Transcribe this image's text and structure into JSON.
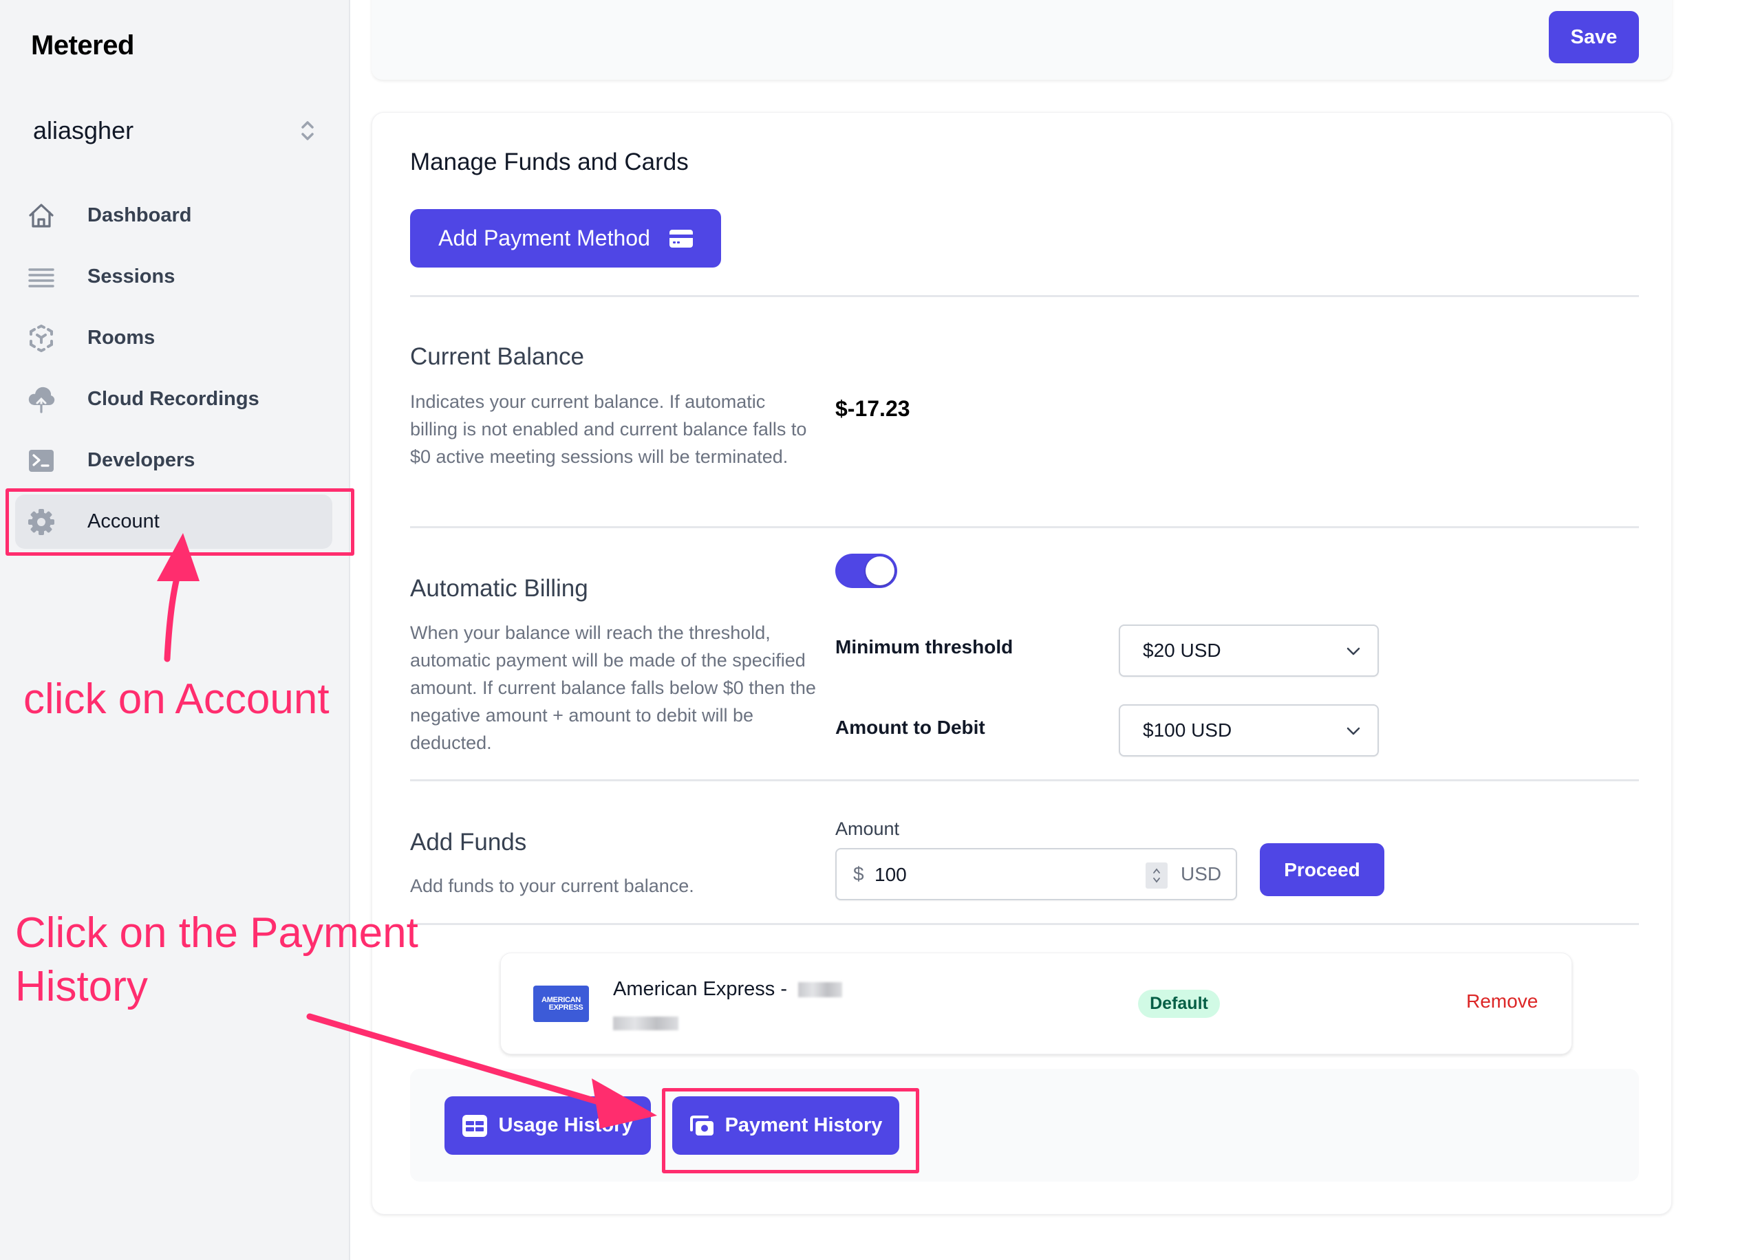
{
  "sidebar": {
    "brand": "Metered",
    "org": {
      "name": "aliasgher",
      "icon": "chevron-up-down-icon"
    },
    "items": [
      {
        "label": "Dashboard",
        "icon": "home-icon",
        "active": false
      },
      {
        "label": "Sessions",
        "icon": "menu-lines-icon",
        "active": false
      },
      {
        "label": "Rooms",
        "icon": "rooms-cube-icon",
        "active": false
      },
      {
        "label": "Cloud Recordings",
        "icon": "cloud-upload-icon",
        "active": false
      },
      {
        "label": "Developers",
        "icon": "terminal-icon",
        "active": false
      },
      {
        "label": "Account",
        "icon": "gear-icon",
        "active": true
      }
    ]
  },
  "toolbar": {
    "save_label": "Save"
  },
  "funds": {
    "title": "Manage Funds and Cards",
    "add_payment_label": "Add Payment Method",
    "add_payment_icon": "credit-card-icon",
    "current_balance": {
      "title": "Current Balance",
      "description": "Indicates your current balance. If automatic billing is not enabled and current balance falls to $0 active meeting sessions will be terminated.",
      "value": "$-17.23"
    },
    "automatic_billing": {
      "title": "Automatic Billing",
      "description": "When your balance will reach the threshold, automatic payment will be made of the specified amount. If current balance falls below $0 then the negative amount + amount to debit will be deducted.",
      "enabled": true,
      "minimum_threshold_label": "Minimum threshold",
      "minimum_threshold_value": "$20 USD",
      "amount_to_debit_label": "Amount to Debit",
      "amount_to_debit_value": "$100 USD"
    },
    "add_funds": {
      "title": "Add Funds",
      "description": "Add funds to your current balance.",
      "amount_label": "Amount",
      "currency_prefix": "$",
      "amount_value": "100",
      "currency_suffix": "USD",
      "proceed_label": "Proceed"
    },
    "payment_methods": [
      {
        "brand_logo_top": "AMERICAN",
        "brand_logo_bottom": "EXPRESS",
        "name": "American Express - ",
        "badge": "Default",
        "remove_label": "Remove"
      }
    ],
    "footer": {
      "usage_history_label": "Usage History",
      "payment_history_label": "Payment History"
    }
  },
  "annotations": {
    "account_hint": "click on Account",
    "payment_hint_line1": "Click on the Payment",
    "payment_hint_line2": "History",
    "color": "#ff2d6e"
  },
  "colors": {
    "primary": "#4f46e5",
    "danger": "#dc2626",
    "badge_bg": "#d1fae5",
    "badge_text": "#065f46",
    "sidebar_bg": "#f3f4f6"
  }
}
